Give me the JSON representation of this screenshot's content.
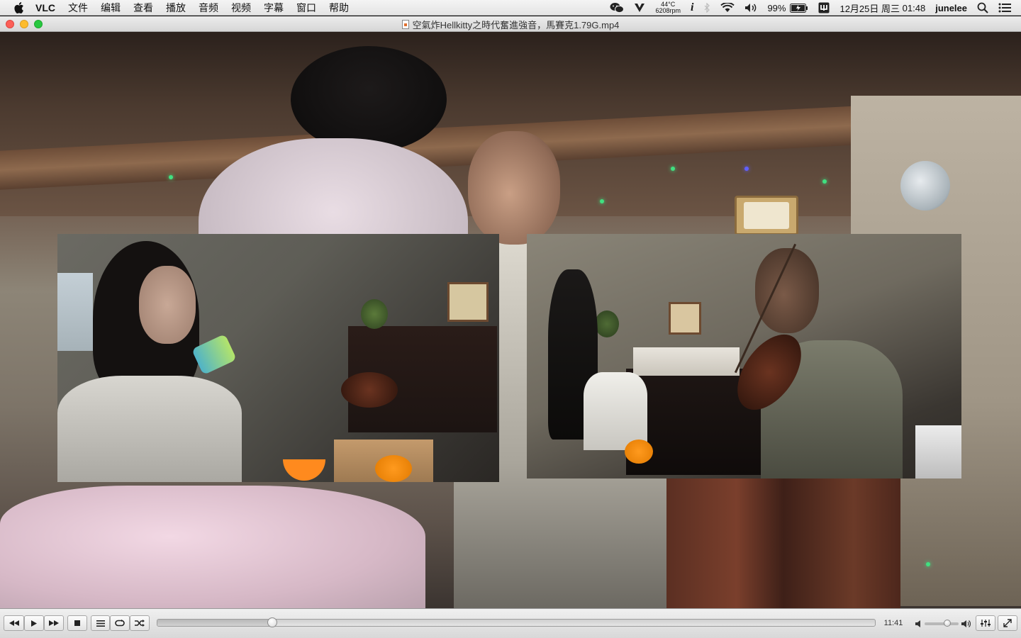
{
  "menubar": {
    "app_name": "VLC",
    "menus": [
      "文件",
      "编辑",
      "查看",
      "播放",
      "音频",
      "视频",
      "字幕",
      "窗口",
      "帮助"
    ],
    "status": {
      "temperature": "44°C",
      "fan_speed": "6208rpm",
      "battery": "99%",
      "date": "12月25日",
      "weekday": "周三",
      "time": "01:48",
      "user": "junelee"
    },
    "icons": [
      "apple-icon",
      "wechat-icon",
      "vpn-icon",
      "info-icon",
      "bluetooth-icon",
      "wifi-icon",
      "volume-icon",
      "battery-icon",
      "input-method-icon",
      "search-icon",
      "notification-center-icon"
    ]
  },
  "window": {
    "title": "空氣炸Hellkitty之時代奮進強音，馬賽克1.79G.mp4"
  },
  "controls": {
    "elapsed": "11:41",
    "progress": 0.16,
    "volume": 0.67,
    "buttons": [
      "rewind-button",
      "play-button",
      "fast-forward-button",
      "stop-button",
      "playlist-button",
      "loop-button",
      "shuffle-button",
      "equalizer-button",
      "fullscreen-button"
    ]
  },
  "colors": {
    "close": "#fc5f57",
    "minimize": "#fdbc2e",
    "zoom": "#28c840"
  }
}
